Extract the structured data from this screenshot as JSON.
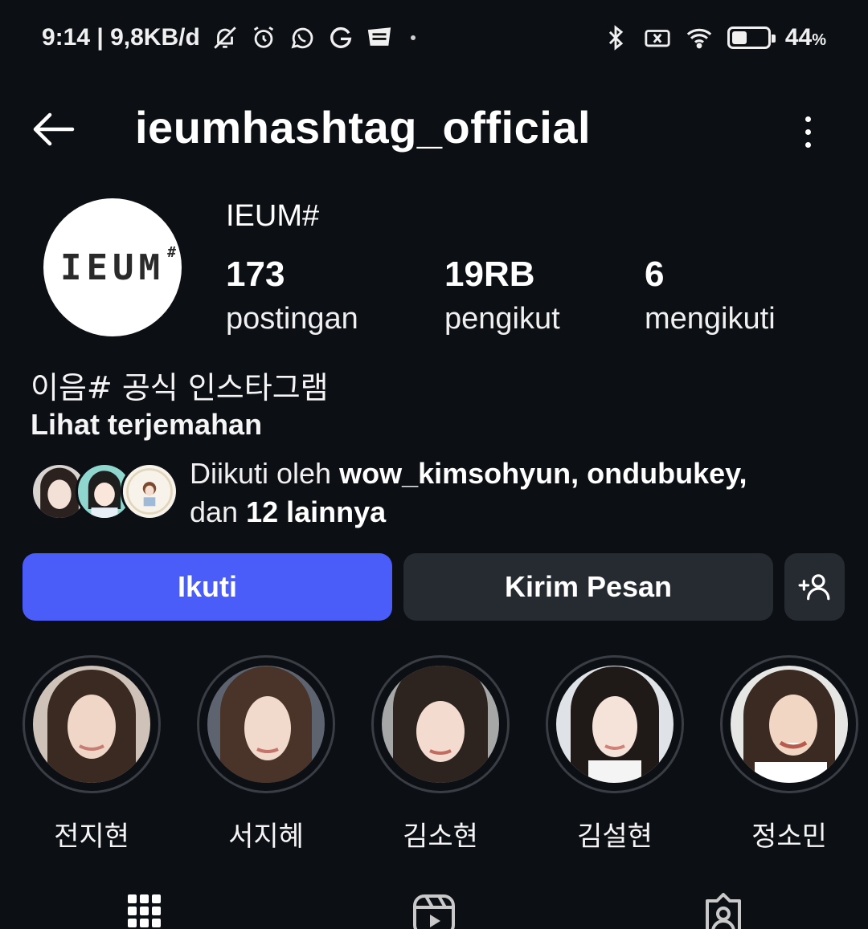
{
  "status_bar": {
    "time_and_speed": "9:14 | 9,8KB/d",
    "battery_percent": "44",
    "battery_unit": "%",
    "battery_level": 0.44,
    "icons": [
      "mute-icon",
      "alarm-icon",
      "whatsapp-icon",
      "g-icon",
      "webtoon-icon",
      "bluetooth-icon",
      "sim-off-icon",
      "wifi-icon",
      "battery-icon"
    ]
  },
  "header": {
    "username": "ieumhashtag_official"
  },
  "profile": {
    "display_name": "IEUM#",
    "avatar_text": "IEUM",
    "avatar_mark": "#",
    "stats": [
      {
        "count": "173",
        "label": "postingan"
      },
      {
        "count": "19RB",
        "label": "pengikut"
      },
      {
        "count": "6",
        "label": "mengikuti"
      }
    ],
    "bio": "이음# 공식 인스타그램",
    "translate": "Lihat terjemahan",
    "followed_by": {
      "prefix": "Diikuti oleh ",
      "names": "wow_kimsohyun, ondubukey,",
      "connector": "dan ",
      "others": "12 lainnya"
    }
  },
  "actions": {
    "follow": "Ikuti",
    "message": "Kirim Pesan"
  },
  "highlights": [
    {
      "label": "전지현"
    },
    {
      "label": "서지혜"
    },
    {
      "label": "김소현"
    },
    {
      "label": "김설현"
    },
    {
      "label": "정소민"
    }
  ],
  "tabs": [
    "grid-icon",
    "reels-icon",
    "tagged-icon"
  ],
  "colors": {
    "background": "#0c0f14",
    "primary_button": "#4a5df9",
    "secondary_button": "#262a31"
  }
}
